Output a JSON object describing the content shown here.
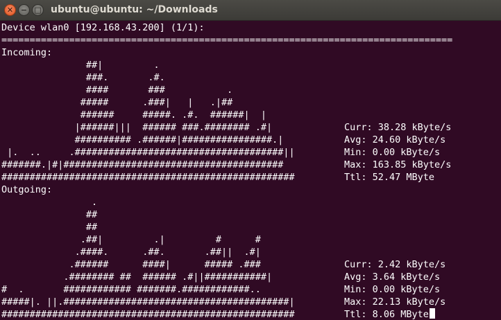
{
  "window": {
    "title": "ubuntu@ubuntu: ~/Downloads",
    "close_glyph": "✕",
    "minimize_glyph": "−",
    "maximize_glyph": "□"
  },
  "terminal": {
    "header": "Device wlan0 [192.168.43.200] (1/1):",
    "separator": "================================================================================",
    "incoming": {
      "label": "Incoming:",
      "graph": [
        "               ##|         .",
        "               ###.       .#.",
        "               ####       ###           .",
        "              #####      .###|   |   .|##",
        "              ######     #####. .#.  ######|  |",
        "             |######|||  ###### ###.######## .#|",
        "             ########## .######|################.|",
        " |.  ..     .#####################################||",
        "#######.|#|####################################### ",
        "#################################################### "
      ],
      "stats": {
        "curr": "Curr: 38.28 kByte/s",
        "avg": "Avg: 24.60 kByte/s",
        "min": "Min: 0.00 kByte/s",
        "max": "Max: 163.85 kByte/s",
        "ttl": "Ttl: 52.47 MByte"
      }
    },
    "outgoing": {
      "label": "Outgoing:",
      "graph": [
        "                .",
        "               ##",
        "               ##",
        "              .##|         .|         #      #",
        "             .####.      .##.       .##||  .#|",
        "            .######      ####|      ##### .###",
        "           .######## ##  ###### .#||###########|",
        "#  .       ############ #######.############..",
        "#####|. ||.########################################|",
        "####################################################"
      ],
      "stats": {
        "curr": "Curr: 2.42 kByte/s",
        "avg": "Avg: 3.64 kByte/s",
        "min": "Min: 0.00 kByte/s",
        "max": "Max: 22.13 kByte/s",
        "ttl": "Ttl: 8.06 MByte"
      }
    }
  }
}
